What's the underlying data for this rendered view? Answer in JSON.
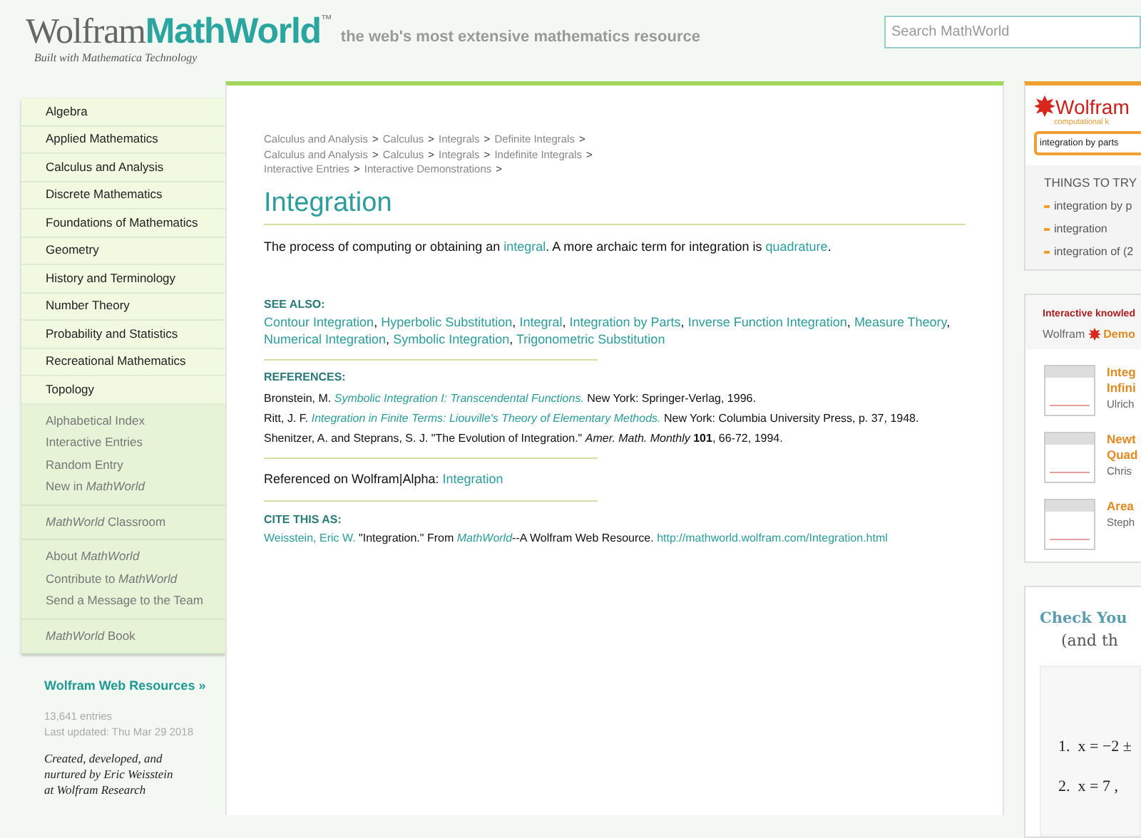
{
  "header": {
    "logo_word": "Wolfram",
    "logo_brand": "MathWorld",
    "logo_mark": "™",
    "logo_subtitle": "Built with Mathematica Technology",
    "tagline": "the web's most extensive mathematics resource",
    "search": {
      "placeholder": "Search MathWorld"
    }
  },
  "sidebar": {
    "categories": [
      "Algebra",
      "Applied Mathematics",
      "Calculus and Analysis",
      "Discrete Mathematics",
      "Foundations of Mathematics",
      "Geometry",
      "History and Terminology",
      "Number Theory",
      "Probability and Statistics",
      "Recreational Mathematics",
      "Topology"
    ],
    "groups": [
      [
        "Alphabetical Index",
        "Interactive Entries",
        "Random Entry",
        "New in *MathWorld*"
      ],
      [
        "*MathWorld* Classroom"
      ],
      [
        "About *MathWorld*",
        "Contribute to *MathWorld*",
        "Send a Message to the Team"
      ],
      [
        "*MathWorld* Book"
      ]
    ],
    "resources_link": "Wolfram Web Resources »",
    "entries": "13,641 entries",
    "updated": "Last updated: Thu Mar 29 2018",
    "credits": [
      "Created, developed, and",
      "nurtured by Eric Weisstein",
      "at Wolfram Research"
    ]
  },
  "article": {
    "breadcrumbs": [
      [
        "Calculus and Analysis",
        "Calculus",
        "Integrals",
        "Definite Integrals"
      ],
      [
        "Calculus and Analysis",
        "Calculus",
        "Integrals",
        "Indefinite Integrals"
      ],
      [
        "Interactive Entries",
        "Interactive Demonstrations"
      ]
    ],
    "separator": ">",
    "title": "Integration",
    "definition": [
      {
        "kind": "text",
        "text": "The process of computing or obtaining an "
      },
      {
        "kind": "link",
        "text": "integral"
      },
      {
        "kind": "text",
        "text": ". A more archaic term for integration is "
      },
      {
        "kind": "link",
        "text": "quadrature"
      },
      {
        "kind": "text",
        "text": "."
      }
    ],
    "see_also_heading": "SEE ALSO:",
    "see_also_separator": ",",
    "see_also": [
      "Contour Integration",
      "Hyperbolic Substitution",
      "Integral",
      "Integration by Parts",
      "Inverse Function Integration",
      "Measure Theory",
      "Numerical Integration",
      "Symbolic Integration",
      "Trigonometric Substitution"
    ],
    "references_heading": "REFERENCES:",
    "references": [
      [
        {
          "kind": "text",
          "text": "Bronstein, M. "
        },
        {
          "kind": "italic_link",
          "text": "Symbolic Integration I: Transcendental Functions."
        },
        {
          "kind": "text",
          "text": " New York: Springer-Verlag, 1996."
        }
      ],
      [
        {
          "kind": "text",
          "text": "Ritt, J. F. "
        },
        {
          "kind": "italic_link",
          "text": "Integration in Finite Terms: Liouville's Theory of Elementary Methods."
        },
        {
          "kind": "text",
          "text": " New York: Columbia University Press, p. 37, 1948."
        }
      ],
      [
        {
          "kind": "text",
          "text": "Shenitzer, A. and Steprans, S. J. \"The Evolution of Integration.\" "
        },
        {
          "kind": "italic",
          "text": "Amer. Math. Monthly "
        },
        {
          "kind": "bold",
          "text": "101"
        },
        {
          "kind": "text",
          "text": ", 66-72, 1994."
        }
      ]
    ],
    "alpha_ref": [
      {
        "kind": "text",
        "text": "Referenced on Wolfram|Alpha: "
      },
      {
        "kind": "link",
        "text": "Integration"
      }
    ],
    "cite_heading": "CITE THIS AS:",
    "cite": [
      {
        "kind": "link",
        "text": "Weisstein, Eric W."
      },
      {
        "kind": "text",
        "text": " \"Integration.\" From "
      },
      {
        "kind": "italic_link",
        "text": "MathWorld"
      },
      {
        "kind": "text",
        "text": "--A Wolfram Web Resource. "
      },
      {
        "kind": "link",
        "text": "http://mathworld.wolfram.com/Integration.html"
      }
    ]
  },
  "alpha_panel": {
    "logo": "Wolfram",
    "tagline": "computational k",
    "query": "integration by parts",
    "things_heading": "THINGS TO TRY",
    "things": [
      "integration by p",
      "integration",
      "integration of (2"
    ]
  },
  "demos_panel": {
    "heading": "Interactive knowled",
    "brand": "Wolfram",
    "brand_part": "Demo",
    "items": [
      {
        "title": [
          "Integ",
          "Infini"
        ],
        "author": "Ulrich"
      },
      {
        "title": [
          "Newt",
          "Quad"
        ],
        "author": "Chris"
      },
      {
        "title": [
          "Area"
        ],
        "author": "Steph"
      }
    ]
  },
  "quiz_panel": {
    "title": "Check You",
    "subtitle": "(and th",
    "items": [
      "1.  x = −2 ±",
      "2.  x = 7 ,"
    ]
  }
}
